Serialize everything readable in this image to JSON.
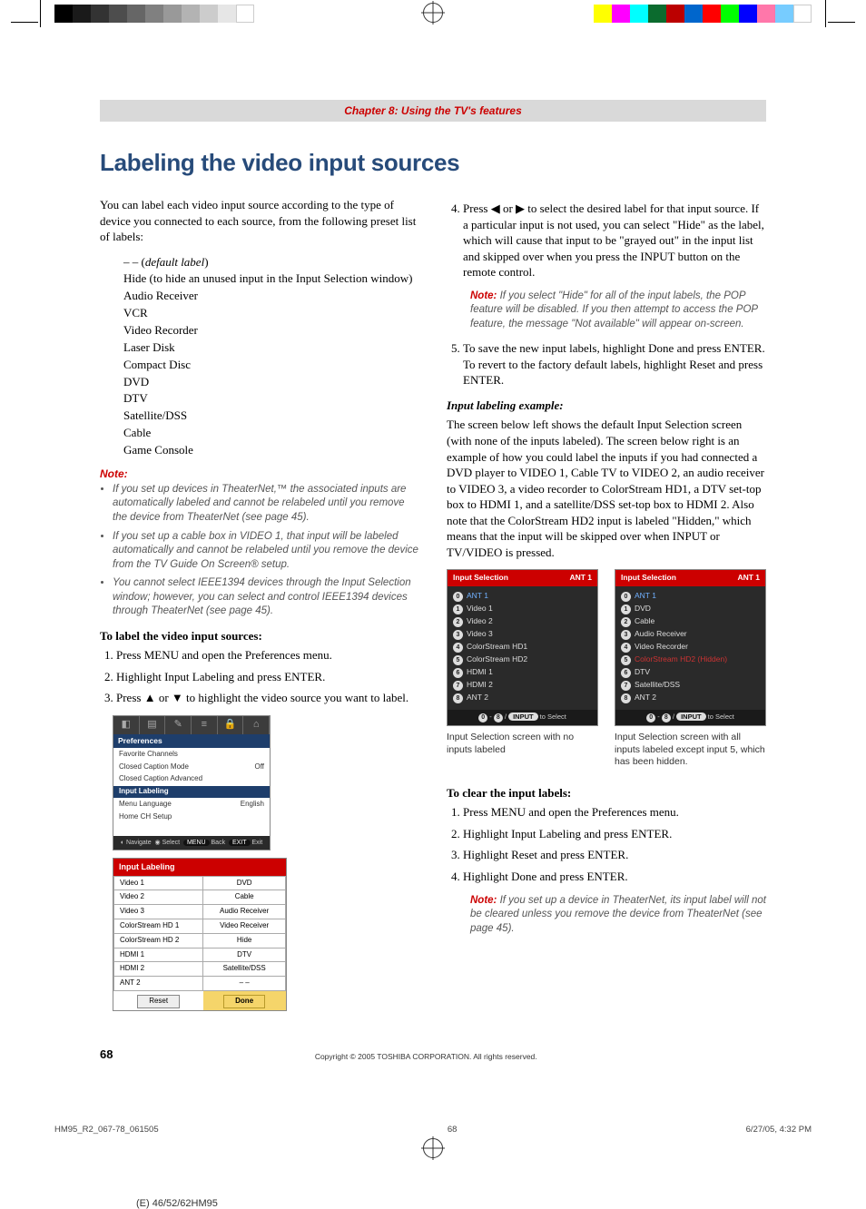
{
  "header": {
    "chapter": "Chapter 8: Using the TV's features"
  },
  "title": "Labeling the video input sources",
  "col_left": {
    "intro": "You can label each video input source according to the type of device you connected to each source, from the following preset list of labels:",
    "labels": {
      "default": "– – (default label)",
      "hide": "Hide (to hide an unused input in the Input Selection window)",
      "l1": "Audio Receiver",
      "l2": "VCR",
      "l3": "Video Recorder",
      "l4": "Laser Disk",
      "l5": "Compact Disc",
      "l6": "DVD",
      "l7": "DTV",
      "l8": "Satellite/DSS",
      "l9": "Cable",
      "l10": "Game Console"
    },
    "note_head": "Note:",
    "notes": {
      "n1": "If you set up devices in TheaterNet,™ the associated inputs are automatically labeled and cannot be relabeled until you remove the device from TheaterNet (see page 45).",
      "n2": "If you set up a cable box in VIDEO 1, that input will be labeled automatically and cannot be relabeled until you remove the device from the TV Guide On Screen® setup.",
      "n3": "You cannot select IEEE1394 devices through the Input Selection window; however, you can select and control IEEE1394 devices through TheaterNet (see page 45)."
    },
    "howto_head": "To label the video input sources:",
    "steps": {
      "s1": "Press MENU and open the Preferences menu.",
      "s2": "Highlight Input Labeling and press ENTER.",
      "s3": "Press ▲ or ▼ to highlight the video source you want to label."
    },
    "osd_prefs": {
      "title": "Preferences",
      "r1": "Favorite Channels",
      "r2l": "Closed Caption Mode",
      "r2r": "Off",
      "r3": "Closed Caption Advanced",
      "hl": "Input Labeling",
      "r4l": "Menu Language",
      "r4r": "English",
      "r5": "Home CH Setup",
      "nav": "Navigate     Select   MENU Back   EXIT Exit"
    },
    "osd_labeling": {
      "title": "Input Labeling",
      "rows": [
        {
          "l": "Video 1",
          "r": "DVD"
        },
        {
          "l": "Video 2",
          "r": "Cable"
        },
        {
          "l": "Video 3",
          "r": "Audio Receiver"
        },
        {
          "l": "ColorStream HD 1",
          "r": "Video Receiver"
        },
        {
          "l": "ColorStream HD 2",
          "r": "Hide"
        },
        {
          "l": "HDMI 1",
          "r": "DTV"
        },
        {
          "l": "HDMI 2",
          "r": "Satellite/DSS"
        },
        {
          "l": "ANT 2",
          "r": "– –"
        }
      ],
      "reset": "Reset",
      "done": "Done"
    }
  },
  "col_right": {
    "step4": "Press ◀ or ▶ to select the desired label for that input source. If a particular input is not used, you can select \"Hide\" as the label, which will cause that input to be \"grayed out\" in the input list and skipped over when you press the INPUT button on the remote control.",
    "note4": "If you select \"Hide\" for all of the input labels, the POP feature will be disabled. If you then attempt to access the POP feature, the message \"Not available\" will appear on-screen.",
    "step5": "To save the new input labels, highlight Done and press ENTER. To revert to the factory default labels, highlight Reset and press ENTER.",
    "example_head": "Input labeling example:",
    "example_body": "The screen below left shows the default Input Selection screen (with none of the inputs labeled). The screen below right is an example of how you could label the inputs if you had connected a DVD player to VIDEO 1, Cable TV to VIDEO 2, an audio receiver to VIDEO 3, a video recorder to ColorStream HD1, a DTV set-top box to HDMI 1, and a satellite/DSS set-top box to HDMI 2. Also note that the ColorStream HD2 input is labeled \"Hidden,\" which means that the input will be skipped over when INPUT or TV/VIDEO is pressed.",
    "sel_left": {
      "title": "Input Selection",
      "ant": "ANT 1",
      "items": [
        "ANT 1",
        "Video 1",
        "Video 2",
        "Video 3",
        "ColorStream HD1",
        "ColorStream HD2",
        "HDMI 1",
        "HDMI 2",
        "ANT 2"
      ],
      "foot": "to Select"
    },
    "sel_right": {
      "title": "Input Selection",
      "ant": "ANT 1",
      "items": [
        "ANT 1",
        "DVD",
        "Cable",
        "Audio Receiver",
        "Video Recorder",
        "ColorStream HD2 (Hidden)",
        "DTV",
        "Satellite/DSS",
        "ANT 2"
      ],
      "foot": "to Select"
    },
    "caption_left": "Input Selection screen with no inputs labeled",
    "caption_right": "Input Selection screen with all inputs labeled except input 5, which has been hidden.",
    "clear_head": "To clear the input labels:",
    "clear": {
      "c1": "Press MENU and open the Preferences menu.",
      "c2": "Highlight Input Labeling and press ENTER.",
      "c3": "Highlight Reset and press ENTER.",
      "c4": "Highlight Done and press ENTER."
    },
    "clear_note": "If you set up a device in TheaterNet, its input label will not be cleared unless you remove the device from TheaterNet (see page 45)."
  },
  "footer": {
    "page": "68",
    "copyright": "Copyright © 2005 TOSHIBA CORPORATION. All rights reserved."
  },
  "meta": {
    "file": "HM95_R2_067-78_061505",
    "pg": "68",
    "date": "6/27/05, 4:32 PM",
    "model": "(E) 46/52/62HM95"
  }
}
